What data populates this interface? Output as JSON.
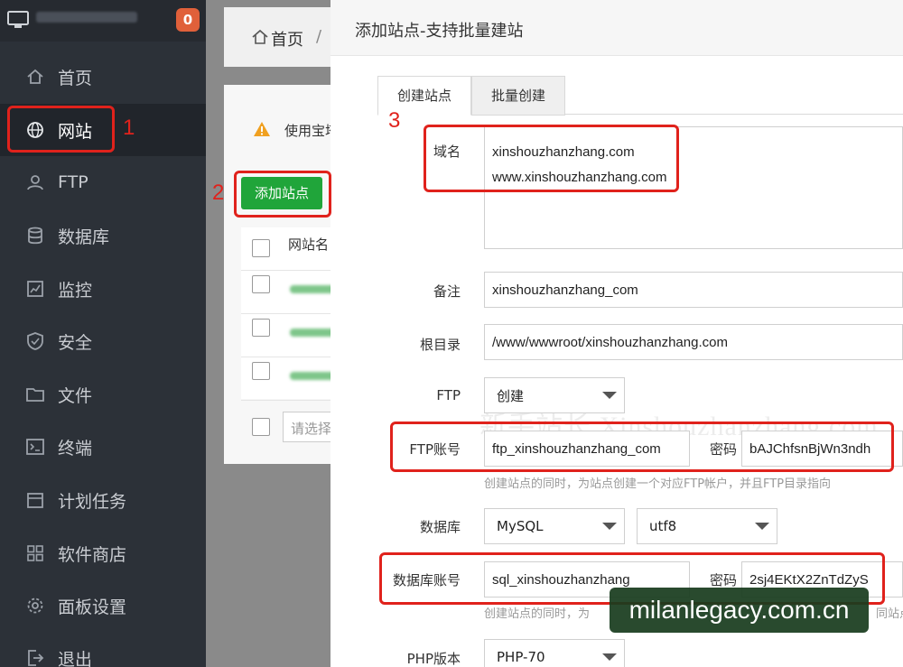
{
  "sidebar": {
    "badge_count": "0",
    "items": [
      {
        "label": "首页"
      },
      {
        "label": "网站"
      },
      {
        "label": "FTP"
      },
      {
        "label": "数据库"
      },
      {
        "label": "监控"
      },
      {
        "label": "安全"
      },
      {
        "label": "文件"
      },
      {
        "label": "终端"
      },
      {
        "label": "计划任务"
      },
      {
        "label": "软件商店"
      },
      {
        "label": "面板设置"
      },
      {
        "label": "退出"
      }
    ]
  },
  "main": {
    "breadcrumb_home": "首页",
    "breadcrumb_sep": "/",
    "warning_text": "使用宝塔",
    "add_site_button": "添加站点",
    "table_header": "网站名",
    "bulk_select_placeholder": "请选择"
  },
  "modal": {
    "title": "添加站点-支持批量建站",
    "tabs": [
      "创建站点",
      "批量创建"
    ],
    "domain_label": "域名",
    "domain_lines": [
      "xinshouzhanzhang.com",
      "www.xinshouzhanzhang.com"
    ],
    "remark_label": "备注",
    "remark_value": "xinshouzhanzhang_com",
    "root_label": "根目录",
    "root_value": "/www/wwwroot/xinshouzhanzhang.com",
    "ftp_label": "FTP",
    "ftp_select": "创建",
    "ftp_account_label": "FTP账号",
    "ftp_account_value": "ftp_xinshouzhanzhang_com",
    "ftp_password_label": "密码",
    "ftp_password_value": "bAJChfsnBjWn3ndh",
    "ftp_hint": "创建站点的同时，为站点创建一个对应FTP帐户，并且FTP目录指向",
    "db_label": "数据库",
    "db_type": "MySQL",
    "db_charset": "utf8",
    "db_account_label": "数据库账号",
    "db_account_value": "sql_xinshouzhanzhang",
    "db_password_label": "密码",
    "db_password_value": "2sj4EKtX2ZnTdZyS",
    "db_hint": "创建站点的同时，为",
    "db_hint_tail": "同站点",
    "php_label": "PHP版本",
    "php_select": "PHP-70",
    "watermark": "新手站长 Xinshouzhanzhang.com"
  },
  "annotations": [
    "1",
    "2",
    "3"
  ],
  "site_watermark": "milanlegacy.com.cn",
  "colors": {
    "sidebar_bg": "#2c3138",
    "accent_green": "#20a53a",
    "annotation_red": "#e0221c",
    "badge_orange": "#e0603a"
  }
}
